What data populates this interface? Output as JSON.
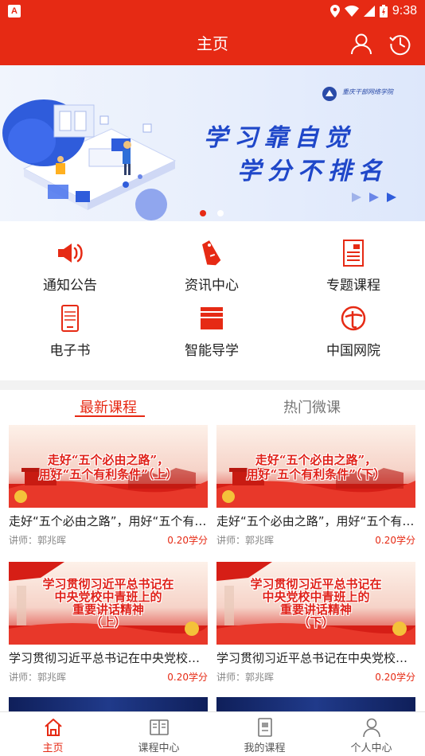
{
  "status_bar": {
    "time": "9:38",
    "app_badge": "A"
  },
  "header": {
    "title": "主页",
    "user_icon": "user-icon",
    "history_icon": "clock-icon"
  },
  "banner": {
    "slogan_line1": "学习靠自觉",
    "slogan_line2": "学分不排名",
    "school_name": "重庆干部网络学院",
    "slide_count": 2,
    "active_slide": 1
  },
  "quick_menu": [
    {
      "label": "通知公告",
      "icon": "megaphone-icon"
    },
    {
      "label": "资讯中心",
      "icon": "tag-icon"
    },
    {
      "label": "专题课程",
      "icon": "document-icon"
    },
    {
      "label": "电子书",
      "icon": "ebook-icon"
    },
    {
      "label": "智能导学",
      "icon": "books-icon"
    },
    {
      "label": "中国网院",
      "icon": "academy-logo-icon"
    }
  ],
  "tabs": {
    "active": "最新课程",
    "inactive": "热门微课"
  },
  "courses": [
    {
      "thumb_line1": "走好“五个必由之路”，",
      "thumb_line2": "用好“五个有利条件”（上）",
      "title": "走好“五个必由之路”，用好“五个有利条件”（上）",
      "lecturer": "讲师：郭兆晖",
      "credit": "0.20学分"
    },
    {
      "thumb_line1": "走好“五个必由之路”，",
      "thumb_line2": "用好“五个有利条件”（下）",
      "title": "走好“五个必由之路”，用好“五个有利条件”（下）",
      "lecturer": "讲师：郭兆晖",
      "credit": "0.20学分"
    },
    {
      "thumb_line1": "学习贯彻习近平总书记在",
      "thumb_line2": "中央党校中青班上的",
      "thumb_line3": "重要讲话精神",
      "thumb_line4": "（上）",
      "title": "学习贯彻习近平总书记在中央党校中青班上的重要讲话精神（上）",
      "lecturer": "讲师：郭兆晖",
      "credit": "0.20学分"
    },
    {
      "thumb_line1": "学习贯彻习近平总书记在",
      "thumb_line2": "中央党校中青班上的",
      "thumb_line3": "重要讲话精神",
      "thumb_line4": "（下）",
      "title": "学习贯彻习近平总书记在中央党校中青班上的重要讲话精神（下）",
      "lecturer": "讲师：郭兆晖",
      "credit": "0.20学分"
    }
  ],
  "bottom_nav": [
    {
      "label": "主页",
      "icon": "home-icon",
      "active": true
    },
    {
      "label": "课程中心",
      "icon": "book-open-icon",
      "active": false
    },
    {
      "label": "我的课程",
      "icon": "my-course-icon",
      "active": false
    },
    {
      "label": "个人中心",
      "icon": "person-icon",
      "active": false
    }
  ],
  "colors": {
    "brand_red": "#e62a14",
    "banner_blue": "#1f47c9"
  }
}
